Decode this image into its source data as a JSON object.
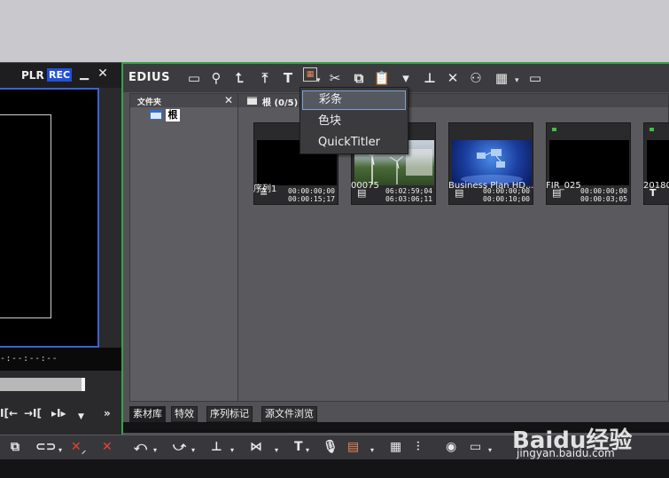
{
  "player": {
    "plr_label": "PLR",
    "rec_label": "REC",
    "timecode": "-:--:--:--"
  },
  "bin": {
    "app_title": "EDIUS",
    "folder_pane": {
      "title": "文件夹",
      "root_node": "根"
    },
    "clip_header": {
      "path": "根 (0/5)"
    },
    "clips": [
      {
        "name": "序列1",
        "type": "sequence",
        "tc_in": "00:00:00;00",
        "tc_out": "00:00:15;17",
        "marker": false
      },
      {
        "name": "00075",
        "type": "video",
        "tc_in": "06:02:59;04",
        "tc_out": "06:03:06;11",
        "marker": false
      },
      {
        "name": "Business Plan HD...",
        "type": "video",
        "tc_in": "00:00:00;00",
        "tc_out": "00:00:10;00",
        "marker": false
      },
      {
        "name": "FIR_025",
        "type": "video",
        "tc_in": "00:00:00;00",
        "tc_out": "00:00:03;05",
        "marker": true
      },
      {
        "name": "20180",
        "type": "title",
        "tc_in": "",
        "tc_out": "",
        "marker": true
      }
    ],
    "tabs": [
      "素材库",
      "特效",
      "序列标记",
      "源文件浏览"
    ],
    "active_tab_index": 0
  },
  "menu": {
    "items": [
      "彩条",
      "色块",
      "QuickTitler"
    ],
    "selected_index": 0
  },
  "watermark": {
    "brand": "Baidu经验",
    "url": "jingyan.baidu.com"
  },
  "colors": {
    "accent_green": "#3aa04a",
    "rec_blue": "#2250d8",
    "selection_border": "#7ea0d8"
  }
}
